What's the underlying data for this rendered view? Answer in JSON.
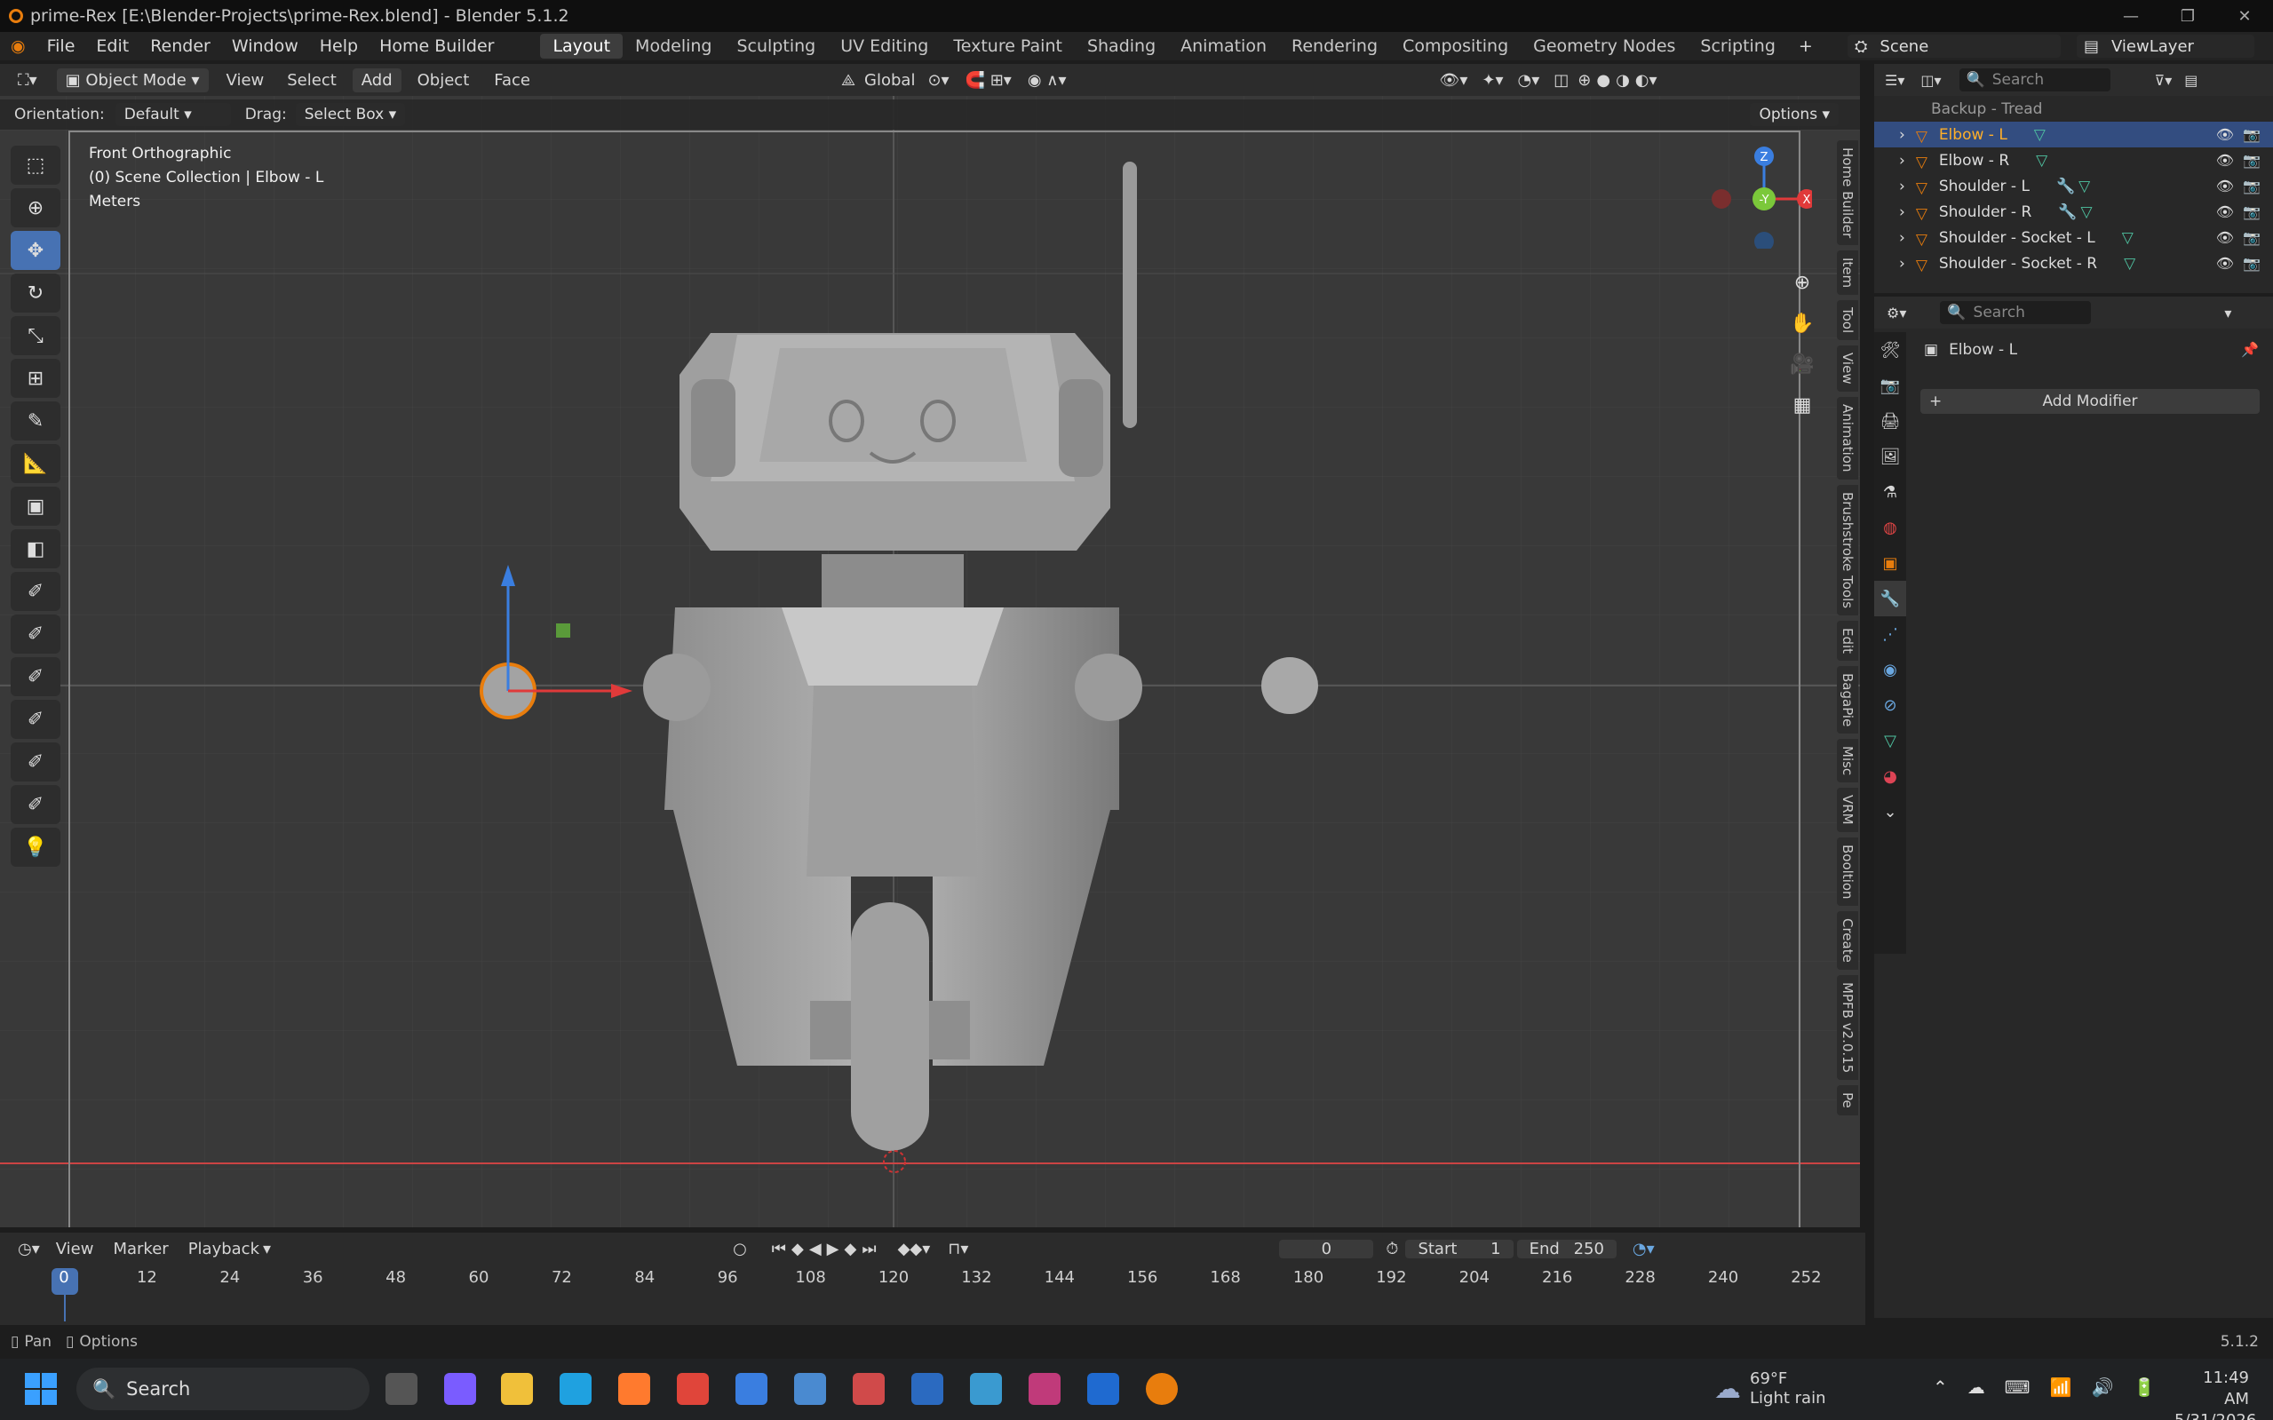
{
  "window": {
    "title": "prime-Rex [E:\\Blender-Projects\\prime-Rex.blend] - Blender 5.1.2"
  },
  "menu": {
    "items": [
      "File",
      "Edit",
      "Render",
      "Window",
      "Help",
      "Home Builder"
    ]
  },
  "workspaces": {
    "tabs": [
      "Layout",
      "Modeling",
      "Sculpting",
      "UV Editing",
      "Texture Paint",
      "Shading",
      "Animation",
      "Rendering",
      "Compositing",
      "Geometry Nodes",
      "Scripting"
    ],
    "active": "Layout"
  },
  "scene": {
    "label": "Scene",
    "view_layer": "ViewLayer"
  },
  "viewport_header": {
    "mode": "Object Mode",
    "menus": [
      "View",
      "Select",
      "Add",
      "Object",
      "Face"
    ],
    "transform": "Global"
  },
  "tool_settings": {
    "orientation_label": "Orientation:",
    "orientation_value": "Default",
    "drag_label": "Drag:",
    "drag_value": "Select Box",
    "options": "Options"
  },
  "viewport_info": {
    "view": "Front Orthographic",
    "collection": "(0) Scene Collection | Elbow - L",
    "units": "Meters"
  },
  "gizmo": {
    "z": "Z",
    "y": "-Y",
    "x": "X"
  },
  "side_tabs": [
    "Home Builder",
    "Item",
    "Tool",
    "View",
    "Animation",
    "Brushstroke Tools",
    "Edit",
    "BagaPie",
    "Misc",
    "VRM",
    "Booltion",
    "Create",
    "MPFB v2.0.15",
    "Pe"
  ],
  "outliner": {
    "search_placeholder": "Search",
    "rows": [
      {
        "name": "Backup - Tread",
        "selected": false
      },
      {
        "name": "Elbow - L",
        "selected": true
      },
      {
        "name": "Elbow - R",
        "selected": false
      },
      {
        "name": "Shoulder - L",
        "selected": false
      },
      {
        "name": "Shoulder - R",
        "selected": false
      },
      {
        "name": "Shoulder - Socket - L",
        "selected": false
      },
      {
        "name": "Shoulder - Socket - R",
        "selected": false
      }
    ]
  },
  "properties": {
    "search_placeholder": "Search",
    "object_name": "Elbow - L",
    "add_modifier": "Add Modifier"
  },
  "timeline": {
    "menus": [
      "View",
      "Marker",
      "Playback"
    ],
    "current_frame": "0",
    "start_label": "Start",
    "start": "1",
    "end_label": "End",
    "end": "250",
    "ticks": [
      "0",
      "12",
      "24",
      "36",
      "48",
      "60",
      "72",
      "84",
      "96",
      "108",
      "120",
      "132",
      "144",
      "156",
      "168",
      "180",
      "192",
      "204",
      "216",
      "228",
      "240",
      "252"
    ]
  },
  "statusbar": {
    "pan": "Pan",
    "options": "Options",
    "version": "5.1.2"
  },
  "taskbar": {
    "search": "Search",
    "weather_temp": "69°F",
    "weather_desc": "Light rain",
    "time": "11:49 AM",
    "date": "5/31/2026"
  },
  "colors": {
    "accent": "#4772b3",
    "selection": "#334d80",
    "active_object": "#e87d0d",
    "viewport_bg": "#393939"
  }
}
